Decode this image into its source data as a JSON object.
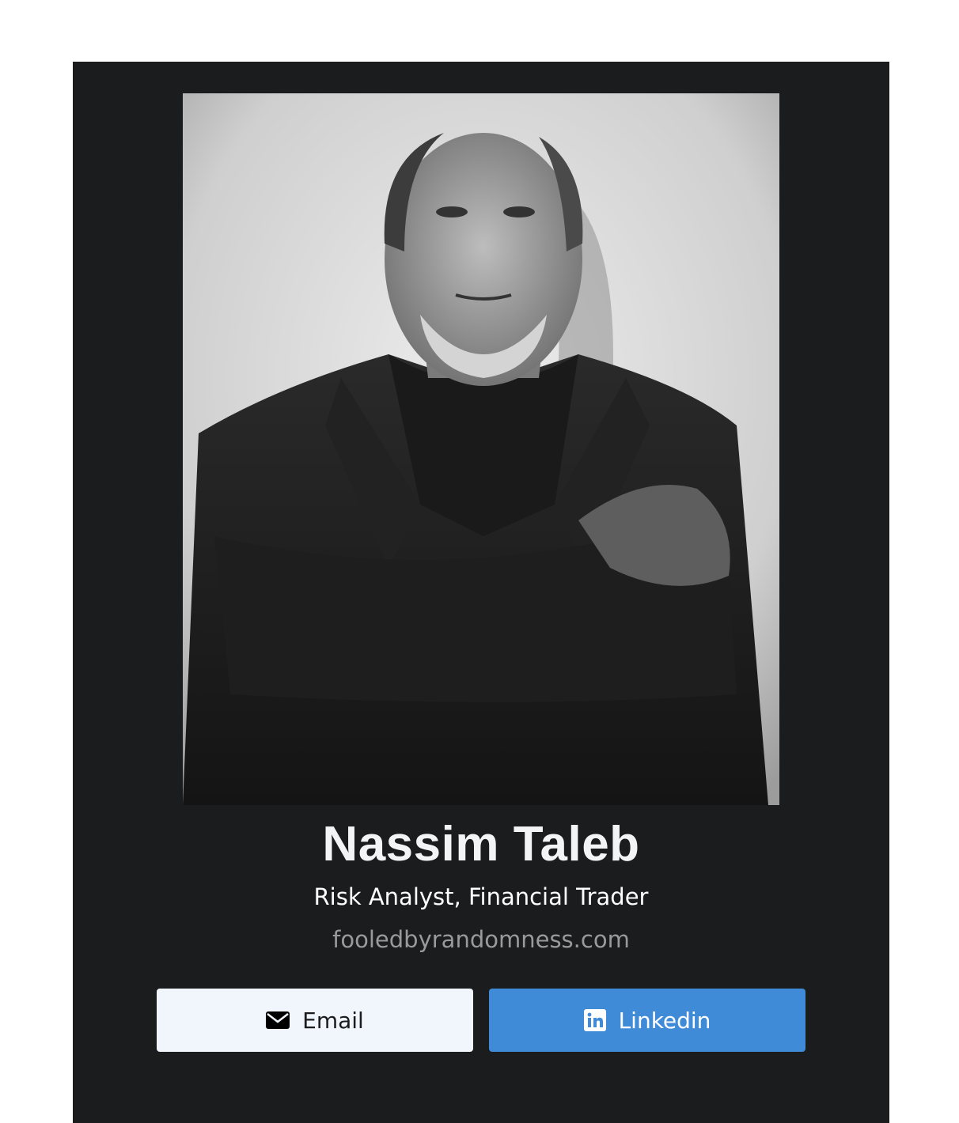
{
  "profile": {
    "name": "Nassim Taleb",
    "title": "Risk Analyst, Financial Trader",
    "website": "fooledbyrandomness.com"
  },
  "buttons": {
    "email_label": "Email",
    "email_icon": "envelope-icon",
    "linkedin_label": "Linkedin",
    "linkedin_icon": "linkedin-icon"
  },
  "colors": {
    "card_background": "#1b1c1e",
    "email_button": "#f1f6fc",
    "linkedin_button": "#3f8bd8",
    "website_text": "#9a9a9a"
  }
}
